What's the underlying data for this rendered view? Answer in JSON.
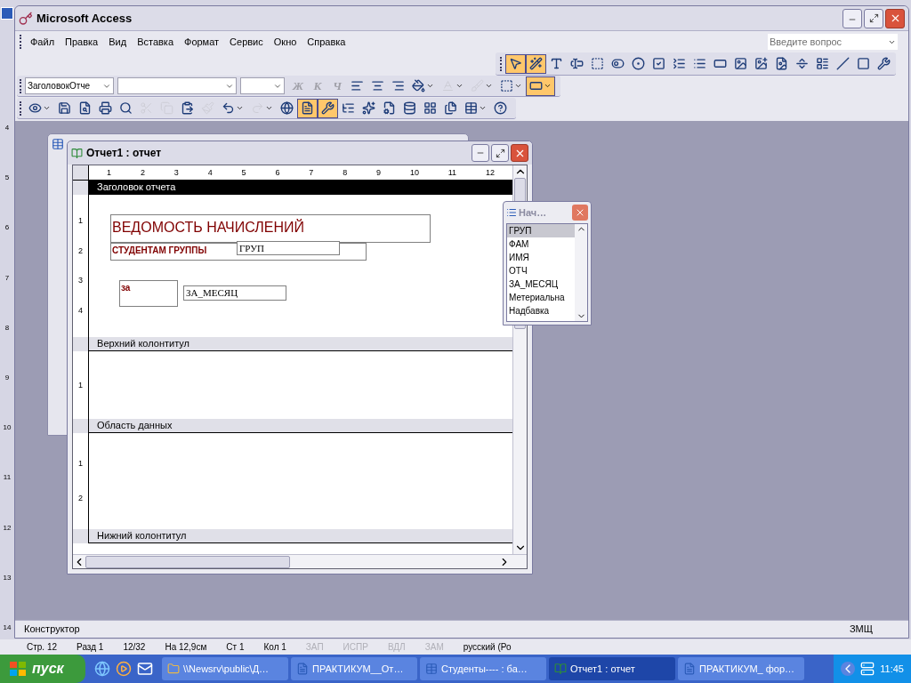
{
  "word_ruler": [
    "4",
    "5",
    "6",
    "7",
    "8",
    "9",
    "10",
    "11",
    "12",
    "13",
    "14"
  ],
  "window": {
    "title": "Microsoft Access"
  },
  "menu": [
    "Файл",
    "Правка",
    "Вид",
    "Вставка",
    "Формат",
    "Сервис",
    "Окно",
    "Справка"
  ],
  "help_field": {
    "placeholder": "Введите вопрос"
  },
  "toolbox": [
    {
      "pressed": true
    },
    {
      "pressed": true
    },
    {
      "pressed": false
    },
    {
      "pressed": false
    },
    {
      "pressed": false
    },
    {
      "pressed": false
    },
    {
      "pressed": false
    },
    {
      "pressed": false
    },
    {
      "pressed": false
    },
    {
      "pressed": false
    },
    {
      "pressed": false
    },
    {
      "pressed": false
    },
    {
      "pressed": false
    },
    {
      "pressed": false
    },
    {
      "pressed": false
    },
    {
      "pressed": false
    },
    {
      "pressed": false
    },
    {
      "pressed": false
    },
    {
      "pressed": false
    }
  ],
  "format_toolbar": {
    "object_combo": "ЗаголовокОтче",
    "style_buttons": [
      {
        "label": "Ж",
        "disabled": true
      },
      {
        "label": "К",
        "disabled": true
      },
      {
        "label": "Ч",
        "disabled": true
      }
    ],
    "tools": [
      {
        "pressed": false,
        "disabled": false
      },
      {
        "pressed": false,
        "disabled": false
      },
      {
        "pressed": false,
        "disabled": false
      },
      {
        "pressed": false,
        "disabled": false
      },
      {
        "pressed": false,
        "disabled": true
      },
      {
        "pressed": false,
        "disabled": true
      },
      {
        "pressed": false,
        "disabled": false
      },
      {
        "pressed": true,
        "disabled": false
      }
    ]
  },
  "standard_toolbar": [
    {
      "pressed": false,
      "disabled": false
    },
    {
      "pressed": false,
      "disabled": false
    },
    {
      "pressed": false,
      "disabled": false
    },
    {
      "pressed": false,
      "disabled": false
    },
    {
      "pressed": false,
      "disabled": false
    },
    {
      "pressed": false,
      "disabled": true
    },
    {
      "pressed": false,
      "disabled": true
    },
    {
      "pressed": false,
      "disabled": false
    },
    {
      "pressed": false,
      "disabled": true
    },
    {
      "pressed": false,
      "disabled": false
    },
    {
      "pressed": false,
      "disabled": true
    },
    {
      "pressed": false,
      "disabled": false
    },
    {
      "pressed": true,
      "disabled": false
    },
    {
      "pressed": true,
      "disabled": false
    },
    {
      "pressed": false,
      "disabled": false
    },
    {
      "pressed": false,
      "disabled": false
    },
    {
      "pressed": false,
      "disabled": false
    },
    {
      "pressed": false,
      "disabled": false
    },
    {
      "pressed": false,
      "disabled": false
    },
    {
      "pressed": false,
      "disabled": false
    },
    {
      "pressed": false,
      "disabled": false
    },
    {
      "pressed": false,
      "disabled": false
    }
  ],
  "report_window": {
    "title": "Отчет1 : отчет",
    "ruler": [
      "1",
      "2",
      "3",
      "4",
      "5",
      "6",
      "7",
      "8",
      "9",
      "10",
      "11",
      "12"
    ],
    "sections": [
      {
        "title": "Заголовок отчета",
        "selected": true,
        "ruler": [
          "1",
          "2",
          "3",
          "4"
        ],
        "controls": [
          {
            "kind": "title_label",
            "text": "ВЕДОМОСТЬ НАЧИСЛЕНИЙ"
          },
          {
            "kind": "label",
            "text": "СТУДЕНТАМ ГРУППЫ"
          },
          {
            "kind": "textbox",
            "text": "ГРУП"
          },
          {
            "kind": "label",
            "text": "за"
          },
          {
            "kind": "textbox",
            "text": "ЗА_МЕСЯЦ"
          }
        ]
      },
      {
        "title": "Верхний колонтитул",
        "selected": false,
        "ruler": [
          "1"
        ]
      },
      {
        "title": "Область данных",
        "selected": false,
        "ruler": [
          "1",
          "2"
        ]
      },
      {
        "title": "Нижний колонтитул",
        "selected": false
      }
    ]
  },
  "field_list": {
    "title": "Нач…",
    "fields": [
      {
        "name": "ГРУП",
        "selected": true
      },
      {
        "name": "ФАМ",
        "selected": false
      },
      {
        "name": "ИМЯ",
        "selected": false
      },
      {
        "name": "ОТЧ",
        "selected": false
      },
      {
        "name": "ЗА_МЕСЯЦ",
        "selected": false
      },
      {
        "name": "Метериальна",
        "selected": false
      },
      {
        "name": "Надбавка",
        "selected": false
      }
    ]
  },
  "status_bar": {
    "mode": "Конструктор",
    "indicator": "ЗМЩ"
  },
  "word_status_bar": [
    {
      "text": "Стр. 12",
      "disabled": false
    },
    {
      "text": "Разд 1",
      "disabled": false
    },
    {
      "text": "12/32",
      "disabled": false
    },
    {
      "text": "На 12,9см",
      "disabled": false
    },
    {
      "text": "Ст 1",
      "disabled": false
    },
    {
      "text": "Кол 1",
      "disabled": false
    },
    {
      "text": "ЗАП",
      "disabled": true
    },
    {
      "text": "ИСПР",
      "disabled": true
    },
    {
      "text": "ВДЛ",
      "disabled": true
    },
    {
      "text": "ЗАМ",
      "disabled": true
    },
    {
      "text": "русский (Ро",
      "disabled": false
    }
  ],
  "taskbar": {
    "start": "пуск",
    "tasks": [
      {
        "label": "\\\\Newsrv\\public\\Д…",
        "selected": false
      },
      {
        "label": "ПРАКТИКУМ__От…",
        "selected": false
      },
      {
        "label": "Студенты---- : ба…",
        "selected": false
      },
      {
        "label": "Отчет1 : отчет",
        "selected": true
      },
      {
        "label": "ПРАКТИКУМ_ фор…",
        "selected": false
      }
    ],
    "clock": "11:45"
  }
}
